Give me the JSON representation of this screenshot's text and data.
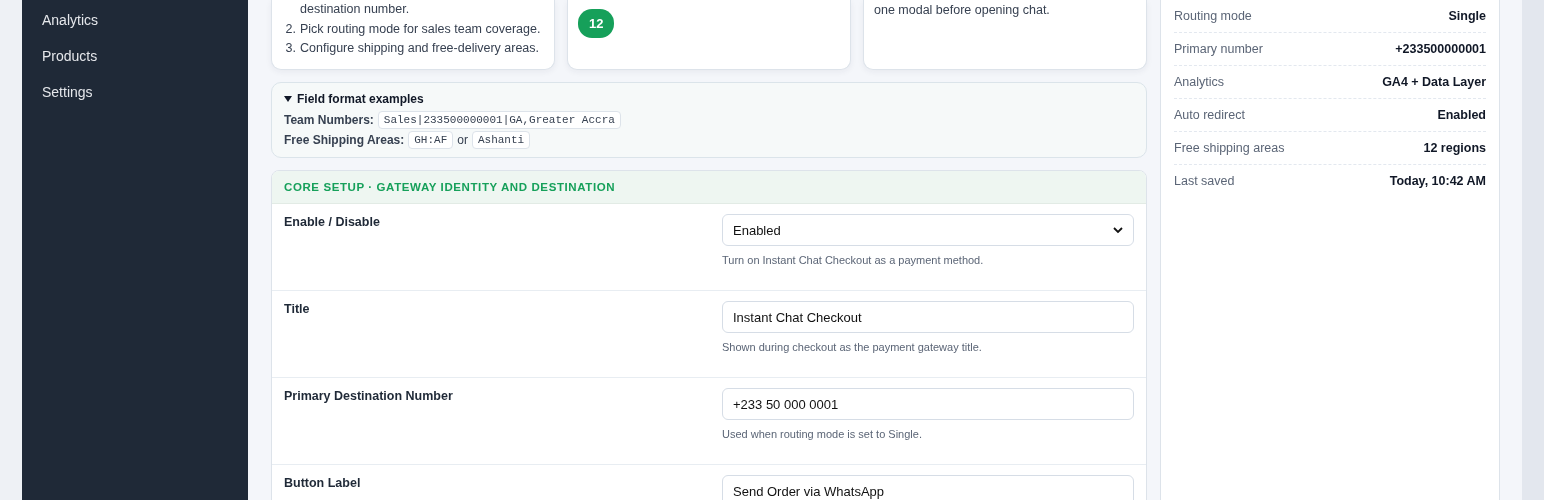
{
  "sidebar": {
    "items": [
      {
        "label": "Analytics",
        "selected": false
      },
      {
        "label": "Products",
        "selected": false
      },
      {
        "label": "Settings",
        "selected": false
      }
    ]
  },
  "cards": [
    {
      "kind": "steps",
      "steps": [
        {
          "text": "destination number."
        },
        {
          "number": "2.",
          "text": "Pick routing mode for sales team coverage."
        },
        {
          "number": "3.",
          "text": "Configure shipping and free-delivery areas."
        }
      ]
    },
    {
      "kind": "badge",
      "badge": "12"
    },
    {
      "kind": "text",
      "text": "one modal before opening chat."
    }
  ],
  "format_examples": {
    "title": "Field format examples",
    "expanded": true,
    "lines": [
      {
        "label": "Team Numbers:",
        "codes": [
          "Sales|233500000001|GA,Greater Accra"
        ]
      },
      {
        "label": "Free Shipping Areas:",
        "codes": [
          "GH:AF",
          "Ashanti"
        ],
        "joiner": "or"
      }
    ]
  },
  "section": {
    "title": "CORE SETUP · GATEWAY IDENTITY AND DESTINATION",
    "fields": [
      {
        "label": "Enable / Disable",
        "kind": "select",
        "value": "Enabled",
        "help": "Turn on Instant Chat Checkout as a payment method."
      },
      {
        "label": "Title",
        "kind": "text",
        "value": "Instant Chat Checkout",
        "help": "Shown during checkout as the payment gateway title."
      },
      {
        "label": "Primary Destination Number",
        "kind": "text",
        "value": "+233 50 000 0001",
        "help": "Used when routing mode is set to Single."
      },
      {
        "label": "Button Label",
        "kind": "text",
        "value": "Send Order via WhatsApp"
      }
    ]
  },
  "summary": {
    "rows": [
      {
        "label": "Routing mode",
        "value": "Single"
      },
      {
        "label": "Primary number",
        "value": "+233500000001"
      },
      {
        "label": "Analytics",
        "value": "GA4 + Data Layer"
      },
      {
        "label": "Auto redirect",
        "value": "Enabled"
      },
      {
        "label": "Free shipping areas",
        "value": "12 regions"
      },
      {
        "label": "Last saved",
        "value": "Today, 10:42 AM"
      }
    ]
  }
}
